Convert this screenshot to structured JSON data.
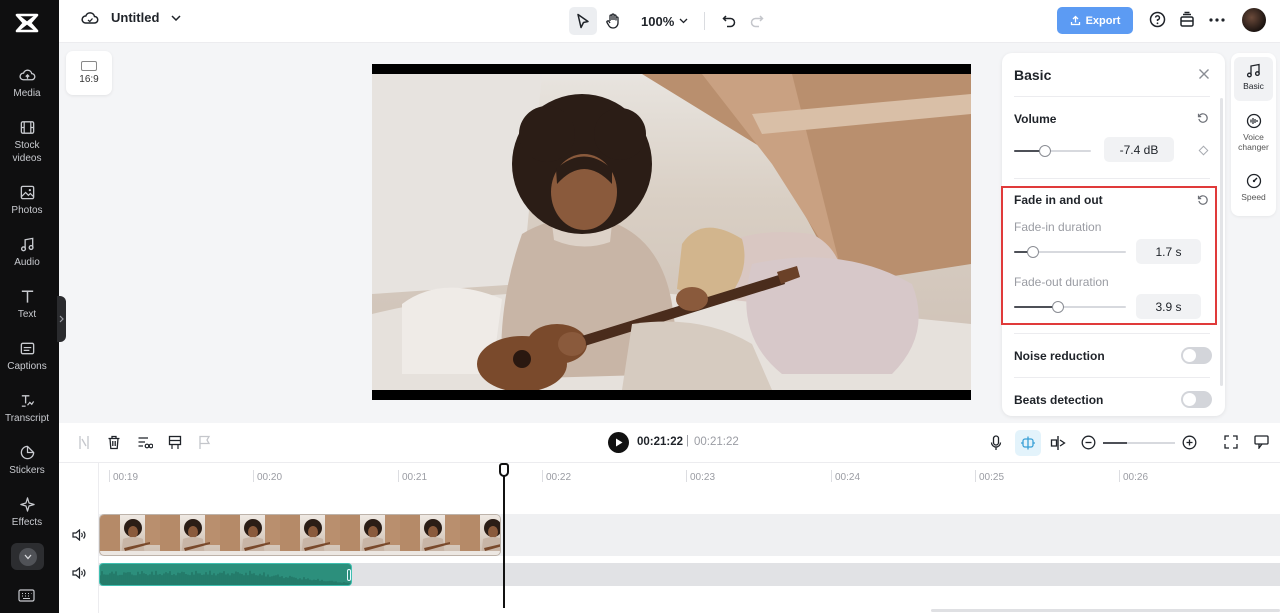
{
  "app": {
    "project_title": "Untitled",
    "zoom_level": "100%",
    "export_label": "Export"
  },
  "sidebar": {
    "items": [
      {
        "label": "Media",
        "icon": "cloud-upload-icon"
      },
      {
        "label": "Stock videos",
        "icon": "film-icon"
      },
      {
        "label": "Photos",
        "icon": "image-icon"
      },
      {
        "label": "Audio",
        "icon": "music-note-icon"
      },
      {
        "label": "Text",
        "icon": "text-t-icon"
      },
      {
        "label": "Captions",
        "icon": "captions-icon"
      },
      {
        "label": "Transcript",
        "icon": "transcript-icon"
      },
      {
        "label": "Stickers",
        "icon": "sticker-icon"
      },
      {
        "label": "Effects",
        "icon": "sparkle-icon"
      }
    ]
  },
  "canvas": {
    "aspect_ratio": "16:9"
  },
  "panel": {
    "title": "Basic",
    "volume": {
      "label": "Volume",
      "value": "-7.4 dB",
      "slider_fraction": 0.4
    },
    "fade": {
      "label": "Fade in and out",
      "fade_in": {
        "label": "Fade-in duration",
        "value": "1.7 s",
        "slider_fraction": 0.17
      },
      "fade_out": {
        "label": "Fade-out duration",
        "value": "3.9 s",
        "slider_fraction": 0.39
      }
    },
    "noise_reduction": {
      "label": "Noise reduction",
      "enabled": false
    },
    "beats_detection": {
      "label": "Beats detection",
      "enabled": false
    }
  },
  "right_tabs": [
    {
      "label": "Basic",
      "icon": "music-note-icon",
      "active": true
    },
    {
      "label": "Voice changer",
      "icon": "waveform-icon",
      "active": false
    },
    {
      "label": "Speed",
      "icon": "speedometer-icon",
      "active": false
    }
  ],
  "timeline": {
    "current_time": "00:21:22",
    "separator": "|",
    "total_time": "00:21:22",
    "ruler_labels": [
      "00:19",
      "00:20",
      "00:21",
      "00:22",
      "00:23",
      "00:24",
      "00:25",
      "00:26"
    ]
  },
  "colors": {
    "accent": "#5c9bf3",
    "highlight": "#e03a3a",
    "audio_clip": "#2c8f7c",
    "sidebar_bg": "#0f0f10"
  }
}
